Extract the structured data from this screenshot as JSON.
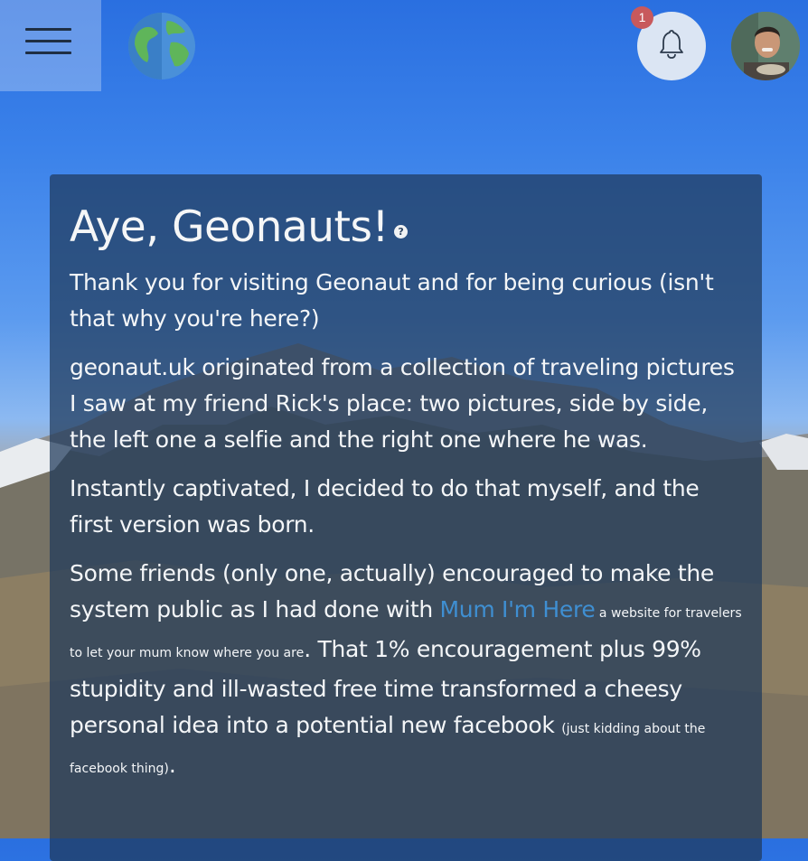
{
  "header": {
    "menu_icon": "hamburger-menu-icon",
    "logo_icon": "globe-logo-icon",
    "notifications_icon": "bell-icon",
    "notification_count": "1",
    "avatar_icon": "user-avatar"
  },
  "card": {
    "title": "Aye, Geonauts!",
    "help_glyph": "?",
    "p1": "Thank you for visiting Geonaut and for being curious (isn't that why you're here?)",
    "p2": "geonaut.uk originated from a collection of traveling pictures I saw at my friend Rick's place: two pictures, side by side, the left one a selfie and the right one where he was.",
    "p3": "Instantly captivated, I decided to do that myself, and the first version was born.",
    "p4_start": "Some friends (only one, actually) encouraged to make the system public as I had done with ",
    "p4_link": "Mum I'm Here",
    "p4_small1": " a website for travelers to let your mum know where you are",
    "p4_mid": ". That 1% encouragement plus 99% stupidity and ill-wasted free time transformed a cheesy personal idea into a potential new facebook ",
    "p4_small2": "(just kidding about the facebook thing)",
    "p4_end": "."
  },
  "colors": {
    "card_bg": "#1f395a",
    "link": "#3f8fd2",
    "badge": "#c8595c",
    "bell_bg": "#dbe5f3"
  }
}
